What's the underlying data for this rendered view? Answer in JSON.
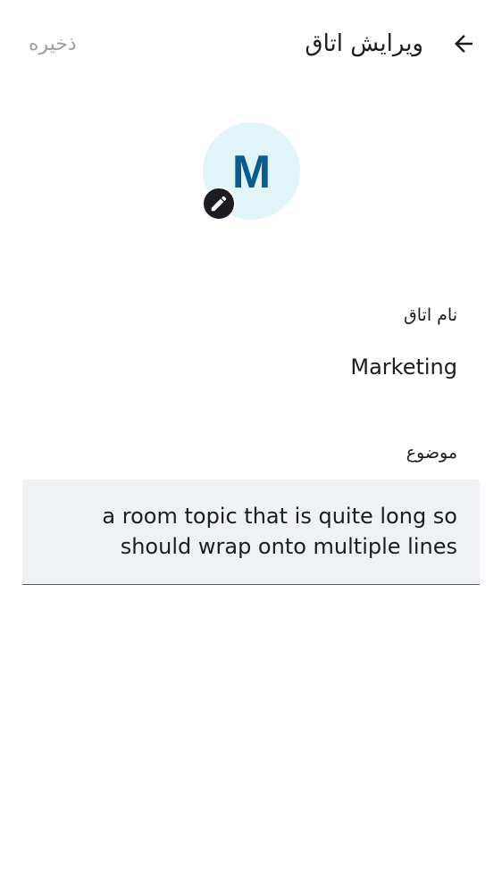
{
  "header": {
    "title": "ویرایش اتاق",
    "save_label": "ذخیره",
    "back_icon": "arrow-left-icon"
  },
  "avatar": {
    "initial": "M",
    "background": "#e1f4f8",
    "letter_color": "#0b5b8c",
    "edit_icon": "pencil-icon"
  },
  "form": {
    "name": {
      "label": "نام اتاق",
      "value": "Marketing"
    },
    "topic": {
      "label": "موضوع",
      "value": "a room topic that is quite long so should wrap onto multiple lines"
    }
  }
}
